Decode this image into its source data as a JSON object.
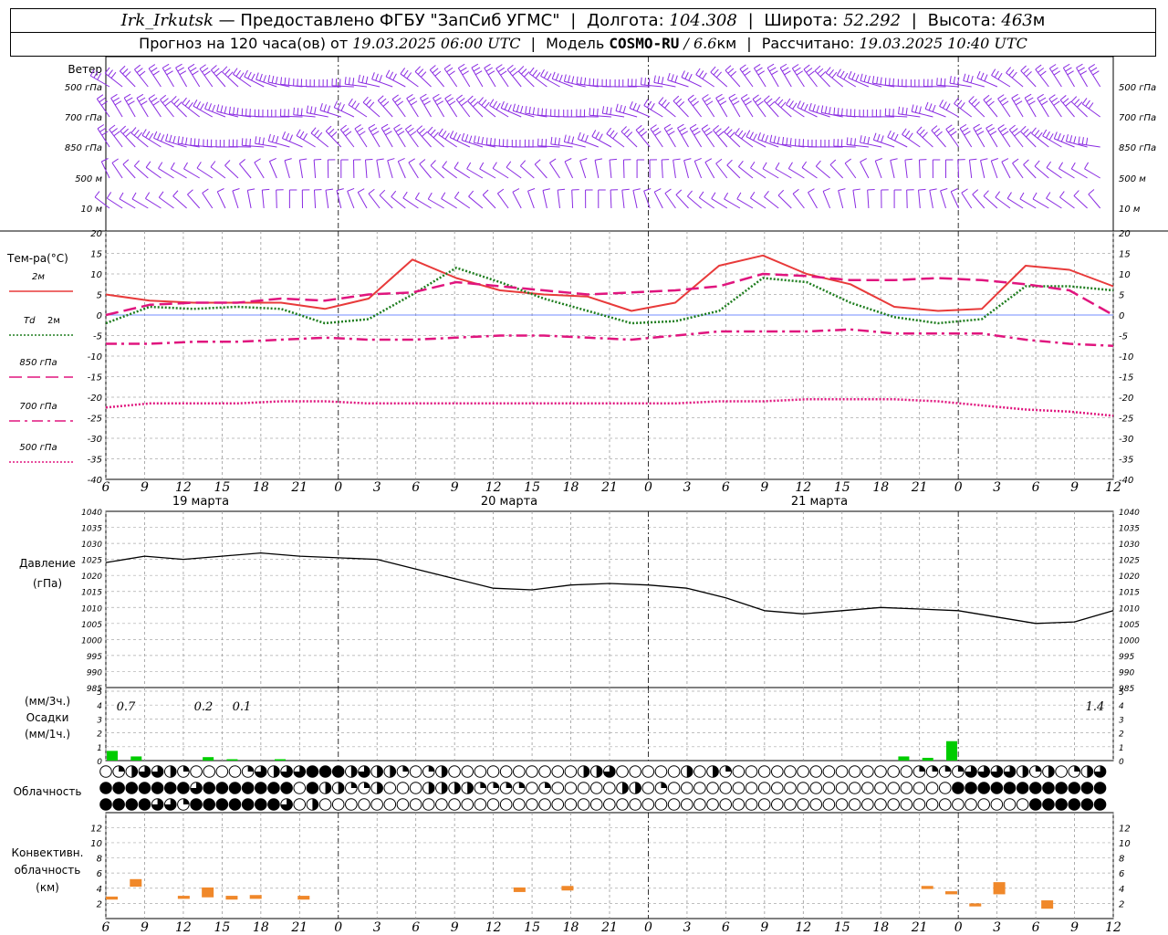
{
  "header": {
    "station": "Irk_Irkutsk",
    "dash": "—",
    "provider": "Предоставлено ФГБУ \"ЗапСиб УГМС\"",
    "lon_label": "Долгота:",
    "lon_value": "104.308",
    "lat_label": "Широта:",
    "lat_value": "52.292",
    "alt_label": "Высота:",
    "alt_value": "463",
    "alt_unit": "м",
    "forecast_prefix": "Прогноз на 120 часа(ов) от",
    "forecast_time": "19.03.2025 06:00 UTC",
    "model_label": "Модель",
    "model_name": "COSMO-RU",
    "model_res": "/ 6.6",
    "model_res_unit": "км",
    "calc_label": "Рассчитано:",
    "calc_time": "19.03.2025 10:40 UTC"
  },
  "chart_data": [
    {
      "type": "wind-barbs",
      "title": "Ветер",
      "levels": [
        "500 гПа",
        "700 гПа",
        "850 гПа",
        "500 м",
        "10 м"
      ],
      "barb_color": "#8a2be2"
    },
    {
      "type": "line",
      "title": "Тем-ра(°С)",
      "ylim": [
        -40,
        20
      ],
      "yticks": [
        20,
        15,
        10,
        5,
        0,
        -5,
        -10,
        -15,
        -20,
        -25,
        -30,
        -35,
        -40
      ],
      "x_hours": [
        0,
        6,
        12,
        18,
        24,
        30,
        36,
        42,
        48,
        54,
        60,
        66,
        72,
        78
      ],
      "series": [
        {
          "name": "2м",
          "color": "#e83a3a",
          "style": "solid",
          "values": [
            5,
            3.5,
            3,
            3,
            3,
            1.5,
            4,
            13.5,
            9,
            6,
            5,
            4.5,
            1,
            3,
            12,
            14.5,
            10,
            7.5,
            2,
            1,
            1.5,
            12,
            11,
            7
          ]
        },
        {
          "name": "Td 2м",
          "color": "#1e7d1e",
          "style": "dotted",
          "values": [
            -2,
            2,
            1.5,
            2,
            1.5,
            -2,
            -1,
            5,
            11.5,
            8,
            4,
            1,
            -2,
            -1.5,
            1,
            9,
            8,
            3,
            -0.5,
            -2,
            -1,
            7,
            7,
            6
          ]
        },
        {
          "name": "850 гПа",
          "color": "#e0157e",
          "style": "longdash",
          "values": [
            0,
            2.5,
            3,
            3,
            4,
            3.5,
            5,
            5.5,
            8,
            7,
            6,
            5,
            5.5,
            6,
            7,
            10,
            9.5,
            8.5,
            8.5,
            9,
            8.5,
            7.5,
            6,
            0
          ]
        },
        {
          "name": "700 гПа",
          "color": "#e0157e",
          "style": "dashdot",
          "values": [
            -7,
            -7,
            -6.5,
            -6.5,
            -6,
            -5.5,
            -6,
            -6,
            -5.5,
            -5,
            -5,
            -5.5,
            -6,
            -5,
            -4,
            -4,
            -4,
            -3.5,
            -4.5,
            -4.5,
            -4.5,
            -6,
            -7,
            -7.5
          ]
        },
        {
          "name": "500 гПа",
          "color": "#e0157e",
          "style": "dotted",
          "values": [
            -22.5,
            -21.5,
            -21.5,
            -21.5,
            -21,
            -21,
            -21.5,
            -21.5,
            -21.5,
            -21.5,
            -21.5,
            -21.5,
            -21.5,
            -21.5,
            -21,
            -21,
            -20.5,
            -20.5,
            -20.5,
            -21,
            -22,
            -23,
            -23.5,
            -24.5
          ]
        }
      ]
    },
    {
      "type": "line",
      "title": "Давление",
      "ylabel": "(гПа)",
      "ylim": [
        985,
        1040
      ],
      "yticks": [
        1040,
        1035,
        1030,
        1025,
        1020,
        1015,
        1010,
        1005,
        1000,
        995,
        990,
        985
      ],
      "series": [
        {
          "name": "Давление",
          "color": "#000000",
          "style": "solid",
          "values": [
            1024,
            1026,
            1025,
            1026,
            1027,
            1026,
            1025.5,
            1025,
            1022,
            1019,
            1016,
            1015.5,
            1017,
            1017.5,
            1017,
            1016,
            1013,
            1009,
            1008,
            1009,
            1010,
            1009.5,
            1009,
            1007,
            1005,
            1005.5,
            1009
          ]
        }
      ]
    },
    {
      "type": "bar",
      "title": "Осадки",
      "ylabel_top": "(мм/3ч.)",
      "ylabel_bottom": "(мм/1ч.)",
      "ylim": [
        0,
        5
      ],
      "yticks": [
        5,
        4,
        3,
        2,
        1,
        0
      ],
      "totals": [
        "0.7",
        "0.2",
        "0.1",
        "1.4"
      ],
      "color": "#00cc00",
      "bars_hour": [
        0,
        3,
        12,
        15,
        21,
        99,
        102,
        105
      ],
      "bars_value": [
        0.7,
        0.3,
        0.25,
        0.1,
        0.1,
        0.3,
        0.2,
        1.4
      ]
    },
    {
      "type": "cloud-cover",
      "title": "Облачность",
      "rows": 3
    },
    {
      "type": "bar",
      "title": "Конвективн. облачность (км)",
      "ylim": [
        0,
        13
      ],
      "yticks": [
        12,
        10,
        8,
        6,
        4,
        2,
        0
      ],
      "color": "#f0882a",
      "segments_hour_start": [
        0,
        3,
        9,
        12,
        15,
        18,
        24,
        51,
        57,
        102,
        105,
        108,
        111,
        117
      ],
      "segments_bottom_km": [
        2.5,
        4.2,
        2.6,
        2.8,
        2.5,
        2.6,
        2.5,
        3.5,
        3.7,
        3.9,
        3.2,
        1.6,
        3.2,
        1.3
      ],
      "segments_top_km": [
        2.9,
        5.2,
        3.0,
        4.1,
        3.0,
        3.1,
        3.0,
        4.1,
        4.3,
        4.3,
        3.6,
        2.0,
        4.8,
        2.4
      ]
    }
  ],
  "x_axis": {
    "tick_labels": [
      "6",
      "9",
      "12",
      "15",
      "18",
      "21",
      "0",
      "3",
      "6",
      "9",
      "12",
      "15",
      "18",
      "21",
      "0",
      "3",
      "6",
      "9",
      "12",
      "15",
      "18",
      "21",
      "0",
      "3",
      "6",
      "9",
      "12"
    ],
    "date_labels": [
      "19 марта",
      "20 марта",
      "21 марта"
    ]
  },
  "legend": {
    "temp2m": "2м",
    "td_prefix": "Td",
    "td_suffix": "2м",
    "l850": "850 гПа",
    "l700": "700 гПа",
    "l500": "500 гПа"
  }
}
